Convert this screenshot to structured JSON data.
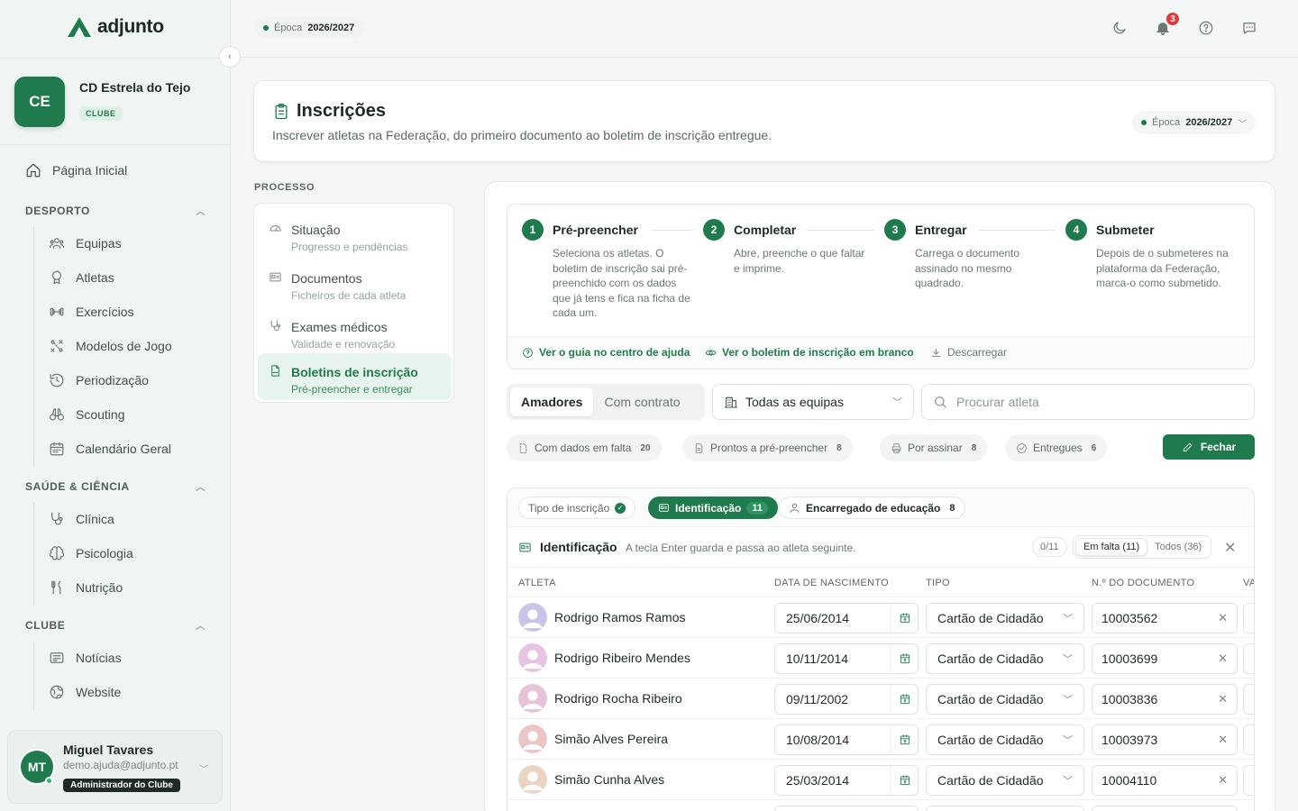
{
  "app": {
    "name": "adjunto",
    "season_label": "Época",
    "season_value": "2026/2027"
  },
  "club": {
    "initials": "CE",
    "name": "CD Estrela do Tejo",
    "badge": "CLUBE"
  },
  "nav": {
    "home": "Página Inicial",
    "sections": [
      {
        "label": "DESPORTO",
        "items": [
          "Equipas",
          "Atletas",
          "Exercícios",
          "Modelos de Jogo",
          "Periodização",
          "Scouting",
          "Calendário Geral"
        ]
      },
      {
        "label": "SAÚDE & CIÊNCIA",
        "items": [
          "Clínica",
          "Psicologia",
          "Nutrição"
        ]
      },
      {
        "label": "CLUBE",
        "items": [
          "Notícias",
          "Website"
        ]
      }
    ]
  },
  "user": {
    "initials": "MT",
    "name": "Miguel Tavares",
    "email": "demo.ajuda@adjunto.pt",
    "role": "Administrador do Clube"
  },
  "topbar": {
    "notifications": "3"
  },
  "page": {
    "title": "Inscrições",
    "subtitle": "Inscrever atletas na Federação, do primeiro documento ao boletim de inscrição entregue."
  },
  "process": {
    "label": "PROCESSO",
    "items": [
      {
        "title": "Situação",
        "sub": "Progresso e pendências"
      },
      {
        "title": "Documentos",
        "sub": "Ficheiros de cada atleta"
      },
      {
        "title": "Exames médicos",
        "sub": "Validade e renovação"
      },
      {
        "title": "Boletins de inscrição",
        "sub": "Pré-preencher e entregar"
      }
    ]
  },
  "steps": [
    {
      "num": "1",
      "title": "Pré-preencher",
      "desc": "Seleciona os atletas. O boletim de inscrição sai pré-preenchido com os dados que já tens e fica na ficha de cada um."
    },
    {
      "num": "2",
      "title": "Completar",
      "desc": "Abre, preenche o que faltar e imprime."
    },
    {
      "num": "3",
      "title": "Entregar",
      "desc": "Carrega o documento assinado no mesmo quadrado."
    },
    {
      "num": "4",
      "title": "Submeter",
      "desc": "Depois de o submeteres na plataforma da Federação, marca-o como submetido."
    }
  ],
  "links": {
    "guide": "Ver o guia no centro de ajuda",
    "blank": "Ver o boletim de inscrição em branco",
    "download": "Descarregar"
  },
  "filters": {
    "segments": [
      "Amadores",
      "Com contrato"
    ],
    "team": "Todas as equipas",
    "search_placeholder": "Procurar atleta",
    "chips": [
      {
        "label": "Com dados em falta",
        "count": "20"
      },
      {
        "label": "Prontos a pré-preencher",
        "count": "8"
      },
      {
        "label": "Por assinar",
        "count": "8"
      },
      {
        "label": "Entregues",
        "count": "6"
      }
    ],
    "close": "Fechar"
  },
  "table": {
    "tabs": [
      {
        "label": "Tipo de inscrição",
        "count": ""
      },
      {
        "label": "Identificação",
        "count": "11"
      },
      {
        "label": "Encarregado de educação",
        "count": "8"
      }
    ],
    "section_title": "Identificação",
    "section_hint": "A tecla Enter guarda e passa ao atleta seguinte.",
    "progress": "0/11",
    "filter_missing": "Em falta (11)",
    "filter_all": "Todos (36)",
    "headers": [
      "ATLETA",
      "DATA DE NASCIMENTO",
      "TIPO",
      "N.º DO DOCUMENTO",
      "VA"
    ],
    "rows": [
      {
        "name": "Rodrigo Ramos Ramos",
        "dob": "25/06/2014",
        "type": "Cartão de Cidadão",
        "doc": "10003562",
        "avatar_color": "#c9c5ea"
      },
      {
        "name": "Rodrigo Ribeiro Mendes",
        "dob": "10/11/2014",
        "type": "Cartão de Cidadão",
        "doc": "10003699",
        "avatar_color": "#e6c4e2"
      },
      {
        "name": "Rodrigo Rocha Ribeiro",
        "dob": "09/11/2002",
        "type": "Cartão de Cidadão",
        "doc": "10003836",
        "avatar_color": "#e8c3d8"
      },
      {
        "name": "Simão Alves Pereira",
        "dob": "10/08/2014",
        "type": "Cartão de Cidadão",
        "doc": "10003973",
        "avatar_color": "#ecc5c9"
      },
      {
        "name": "Simão Cunha Alves",
        "dob": "25/03/2014",
        "type": "Cartão de Cidadão",
        "doc": "10004110",
        "avatar_color": "#ead4c2"
      }
    ]
  },
  "colors": {
    "brand": "#1f7a4d",
    "alert": "#e0393e"
  }
}
